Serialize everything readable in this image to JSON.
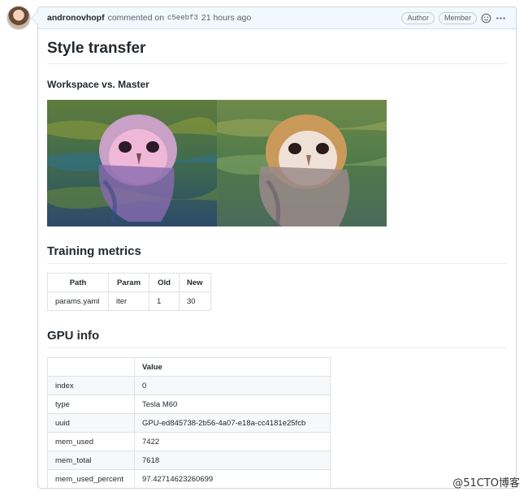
{
  "comment": {
    "author": "andronovhopf",
    "action": "commented on",
    "commit": "c5eebf3",
    "time": "21 hours ago",
    "badges": [
      "Author",
      "Member"
    ]
  },
  "content": {
    "title": "Style transfer",
    "subtitle": "Workspace vs. Master",
    "metrics_heading": "Training metrics",
    "gpu_heading": "GPU info"
  },
  "metrics_table": {
    "headers": [
      "Path",
      "Param",
      "Old",
      "New"
    ],
    "rows": [
      [
        "params.yaml",
        "iter",
        "1",
        "30"
      ]
    ]
  },
  "gpu_table": {
    "headers": [
      "",
      "Value"
    ],
    "rows": [
      [
        "index",
        "0"
      ],
      [
        "type",
        "Tesla M60"
      ],
      [
        "uuid",
        "GPU-ed845738-2b56-4a07-e18a-cc4181e25fcb"
      ],
      [
        "mem_used",
        "7422"
      ],
      [
        "mem_total",
        "7618"
      ],
      [
        "mem_used_percent",
        "97.42714623260699"
      ]
    ]
  },
  "watermark": "@51CTO博客",
  "icons": {
    "reaction": "smiley-icon",
    "menu": "kebab-icon"
  }
}
